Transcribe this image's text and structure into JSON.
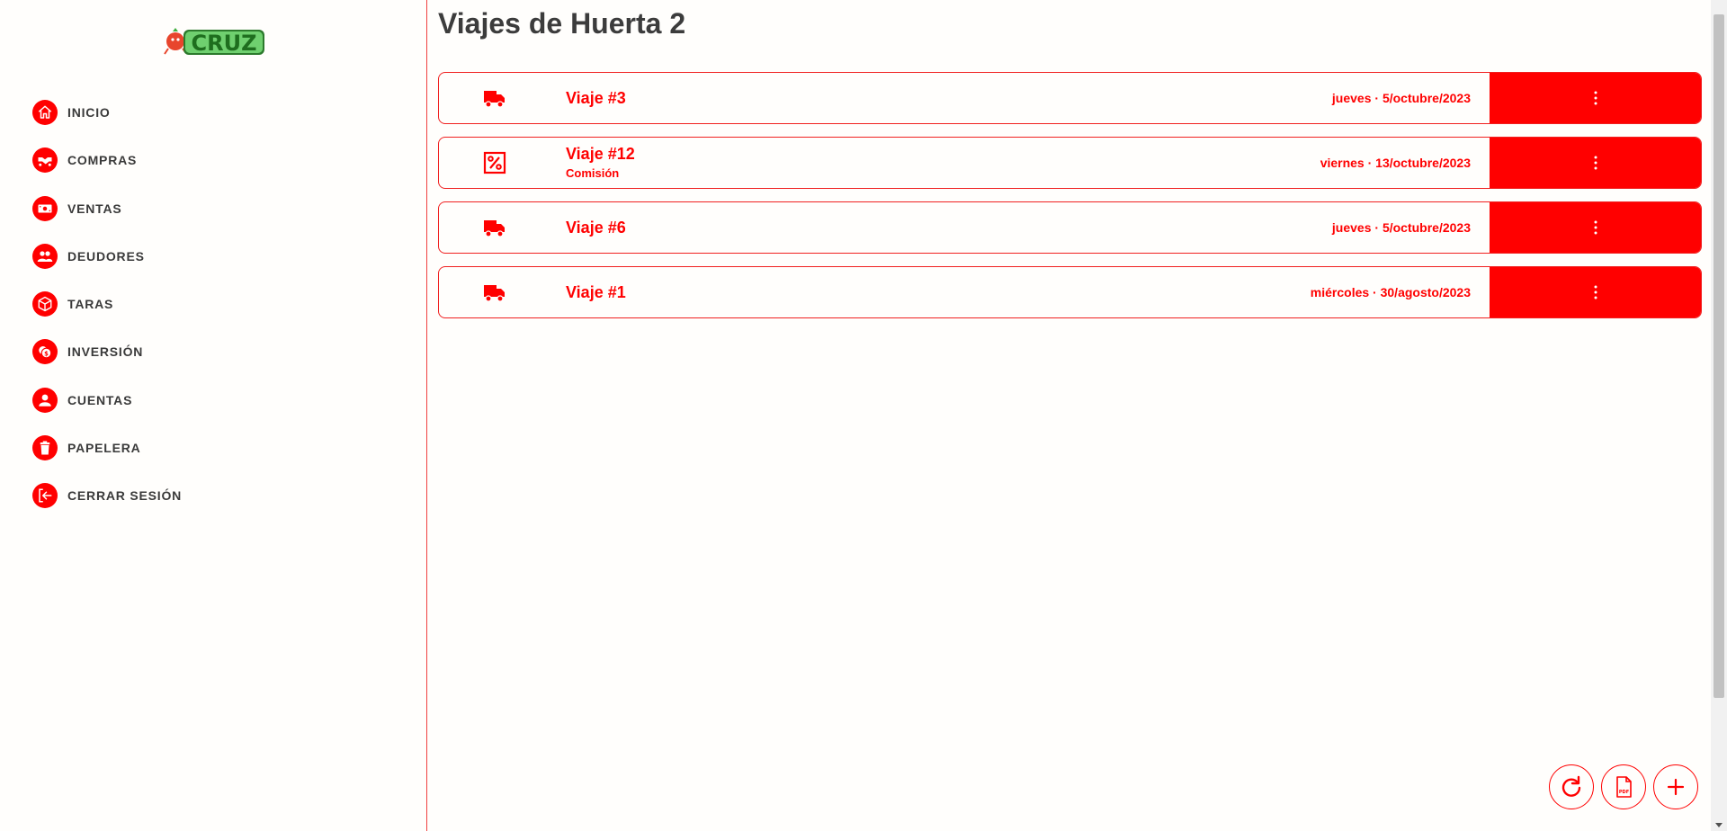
{
  "app": {
    "logo_text": "CRUZ",
    "accent_color": "#ff0000"
  },
  "sidebar": {
    "items": [
      {
        "label": "INICIO",
        "icon": "home-icon"
      },
      {
        "label": "COMPRAS",
        "icon": "handshake-icon"
      },
      {
        "label": "VENTAS",
        "icon": "money-icon"
      },
      {
        "label": "DEUDORES",
        "icon": "users-icon"
      },
      {
        "label": "TARAS",
        "icon": "box-icon"
      },
      {
        "label": "INVERSIÓN",
        "icon": "coins-icon"
      },
      {
        "label": "CUENTAS",
        "icon": "user-icon"
      },
      {
        "label": "PAPELERA",
        "icon": "trash-icon"
      },
      {
        "label": "CERRAR SESIÓN",
        "icon": "logout-icon"
      }
    ]
  },
  "main": {
    "title": "Viajes de Huerta 2",
    "trips": [
      {
        "name": "Viaje #3",
        "subtitle": "",
        "date": "jueves · 5/octubre/2023",
        "icon": "truck-icon"
      },
      {
        "name": "Viaje #12",
        "subtitle": "Comisión",
        "date": "viernes · 13/octubre/2023",
        "icon": "percent-icon"
      },
      {
        "name": "Viaje #6",
        "subtitle": "",
        "date": "jueves · 5/octubre/2023",
        "icon": "truck-icon"
      },
      {
        "name": "Viaje #1",
        "subtitle": "",
        "date": "miércoles · 30/agosto/2023",
        "icon": "truck-icon"
      }
    ]
  },
  "actions": [
    {
      "name": "refresh-button",
      "icon": "refresh-icon"
    },
    {
      "name": "pdf-button",
      "icon": "pdf-icon"
    },
    {
      "name": "add-button",
      "icon": "plus-icon"
    }
  ]
}
